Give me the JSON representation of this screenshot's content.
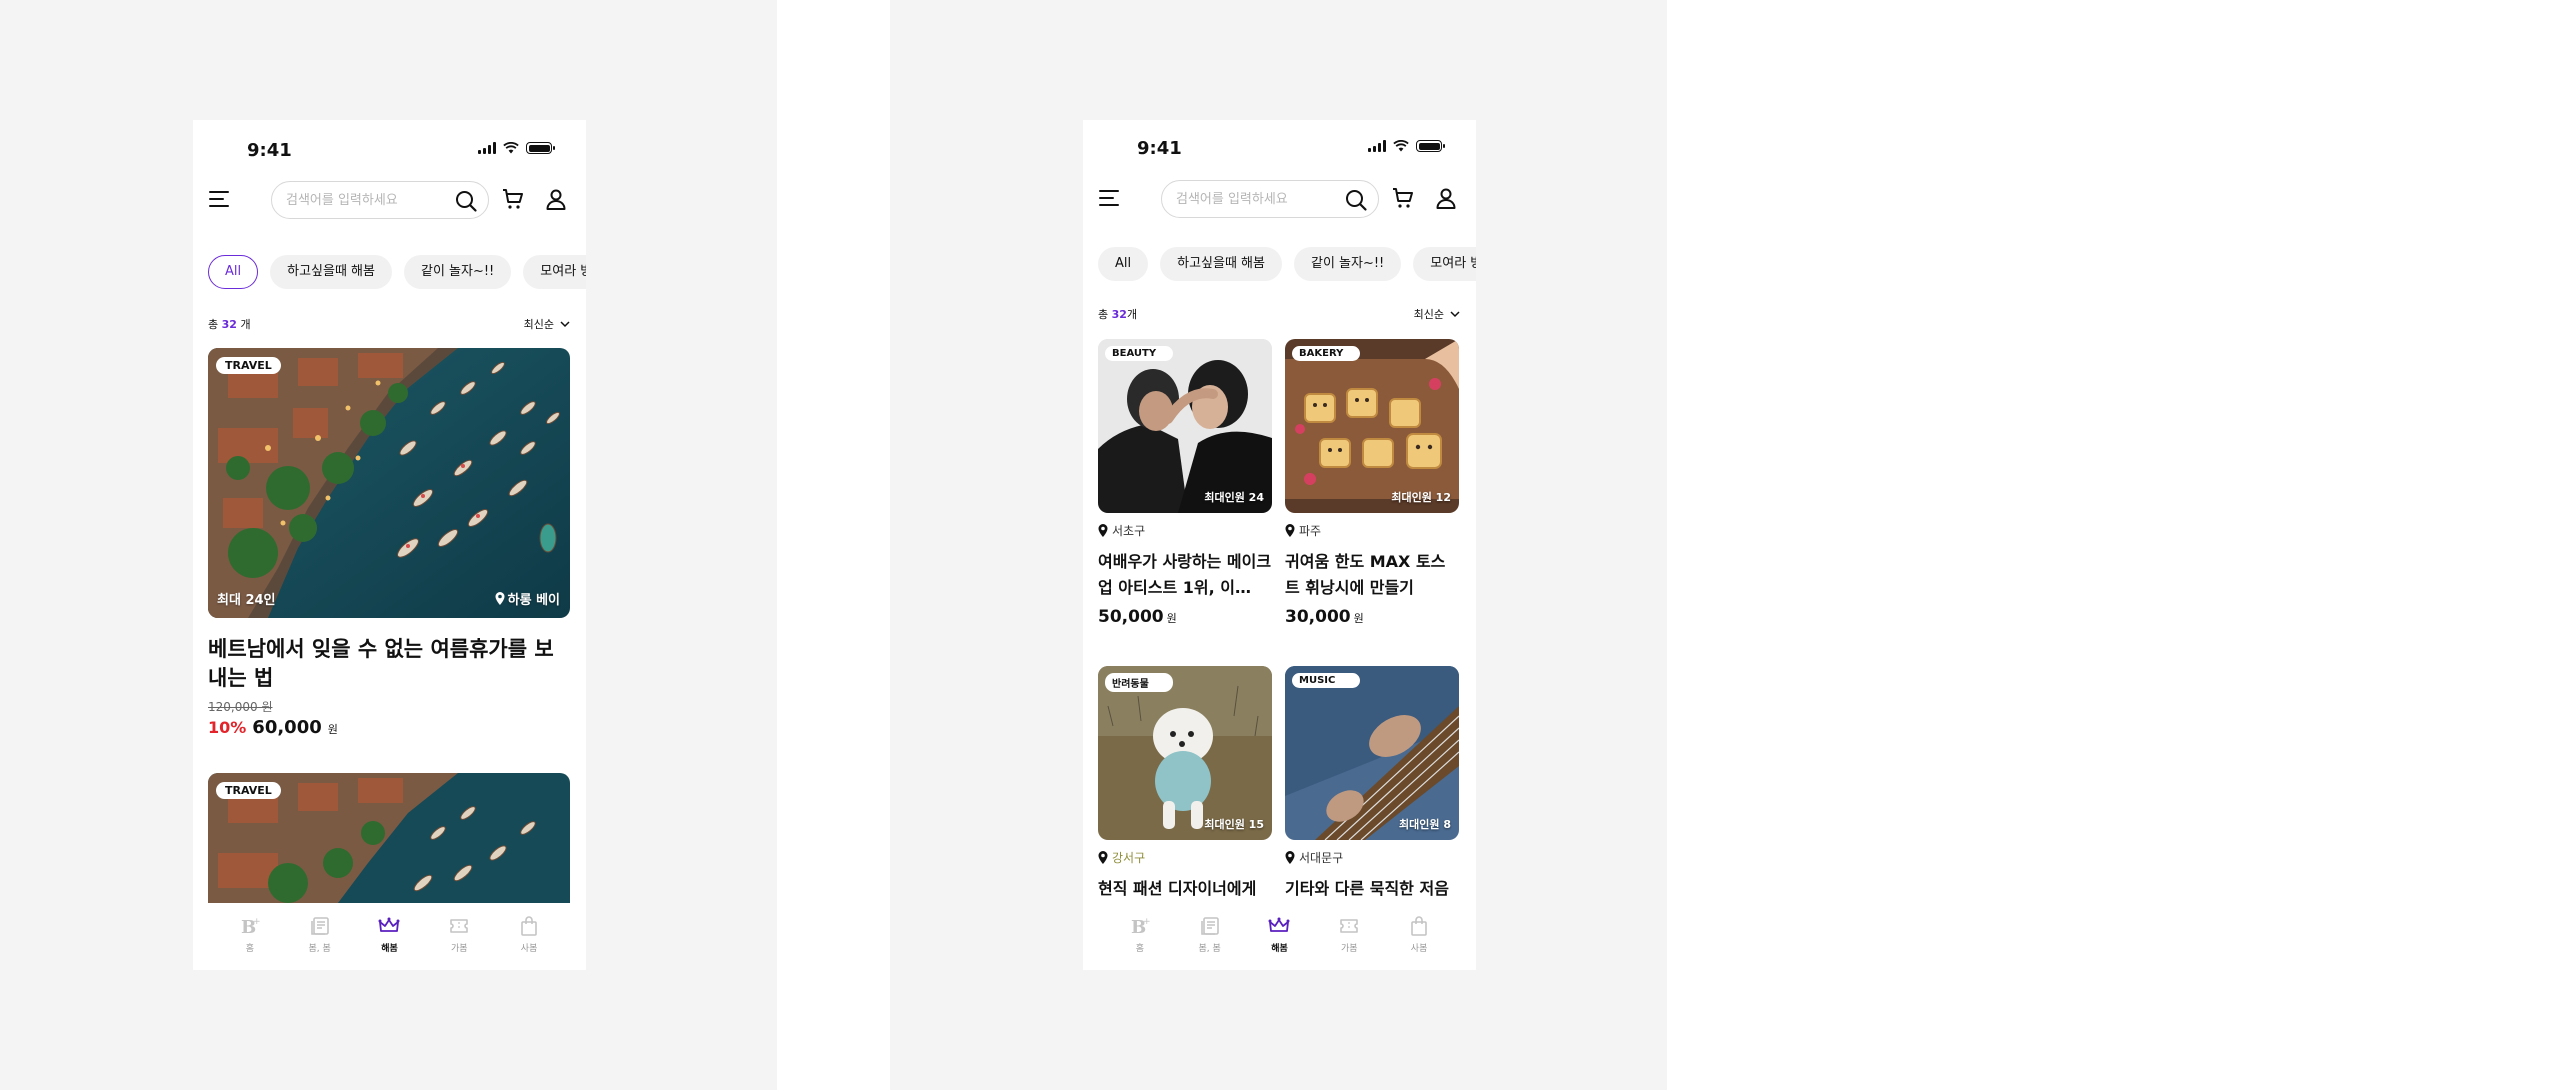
{
  "status": {
    "time": "9:41"
  },
  "search": {
    "placeholder": "검색어를 입력하세요"
  },
  "chips": [
    "All",
    "하고싶을때 해봄",
    "같이 놀자~!!",
    "모여라 방방"
  ],
  "count": {
    "prefix": "총",
    "num": "32",
    "suffix": "개"
  },
  "sort_label": "최신순",
  "feature": {
    "tag": "TRAVEL",
    "capacity": "최대 24인",
    "location": "하롱 베이",
    "title": "베트남에서 잊을 수 없는 여름휴가를 보내는 법",
    "old_price": "120,000 원",
    "discount": "10%",
    "price": "60,000",
    "won": "원"
  },
  "feature2": {
    "tag": "TRAVEL"
  },
  "grid": [
    {
      "tag": "BEAUTY",
      "capacity": "최대인원 24",
      "location": "서초구",
      "title": "여배우가 사랑하는 메이크업 아티스트 1위, 이…",
      "price": "50,000",
      "won": "원"
    },
    {
      "tag": "BAKERY",
      "capacity": "최대인원 12",
      "location": "파주",
      "title": "귀여움 한도 MAX 토스트 휘낭시에 만들기",
      "price": "30,000",
      "won": "원"
    },
    {
      "tag": "반려동물",
      "capacity": "최대인원 15",
      "location": "강서구",
      "title": "현직 패션 디자이너에게"
    },
    {
      "tag": "MUSIC",
      "capacity": "최대인원 8",
      "location": "서대문구",
      "title": "기타와 다른 묵직한 저음"
    }
  ],
  "tabs": [
    {
      "label": "홈",
      "icon": "brand-b-icon"
    },
    {
      "label": "봄, 봄",
      "icon": "news-icon"
    },
    {
      "label": "해봄",
      "icon": "crown-icon"
    },
    {
      "label": "가봄",
      "icon": "ticket-icon"
    },
    {
      "label": "사봄",
      "icon": "bag-icon"
    }
  ],
  "colors": {
    "accent": "#6a2bd9",
    "discount": "#e3242b",
    "background": "#f4f4f4"
  }
}
